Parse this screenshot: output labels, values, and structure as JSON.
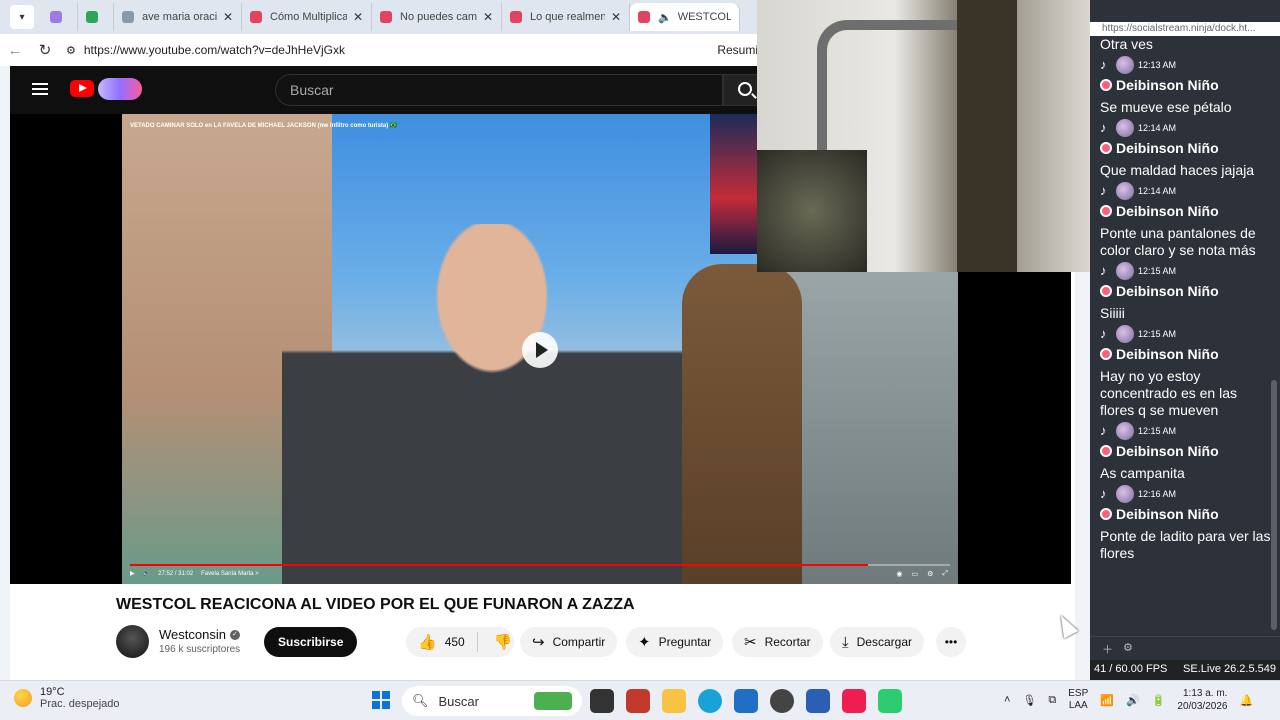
{
  "browser": {
    "tabs": [
      {
        "label": "",
        "color": "#9c7ce0"
      },
      {
        "label": "",
        "color": "#2da65a"
      },
      {
        "label": "ave maria oración",
        "color": "#8899aa"
      },
      {
        "label": "Cómo Multiplicar",
        "color": "#e2445f"
      },
      {
        "label": "No puedes cambi",
        "color": "#e2445f"
      },
      {
        "label": "Lo que realmente",
        "color": "#e2445f"
      },
      {
        "label": "WESTCOL RE",
        "color": "#e2445f"
      }
    ],
    "url": "https://www.youtube.com/watch?v=deJhHeVjGxk",
    "right_label": "Resumi"
  },
  "youtube": {
    "search_placeholder": "Buscar",
    "video_overlay_title": "VETADO CAMINAR SOLO en LA FAVELA DE MICHAEL JACKSON (me infiltro como turista) 🇧🇷",
    "time": "27:52 / 31:02",
    "chapter": "Favela Santa Marta >",
    "progress_fraction": 0.9,
    "video_title": "WESTCOL REACICONA AL VIDEO POR EL QUE FUNARON A ZAZZA",
    "channel": "Westconsin",
    "subscribers": "196 k suscriptores",
    "subscribe": "Suscribirse",
    "likes": "450",
    "share": "Compartir",
    "ask": "Preguntar",
    "clip": "Recortar",
    "download": "Descargar"
  },
  "chat": {
    "url": "https://socialstream.ninja/dock.ht...",
    "first_text": "Otra ves",
    "messages": [
      {
        "time": "12:13 AM",
        "name": "Deibinson Niño",
        "text": "Se mueve ese pétalo"
      },
      {
        "time": "12:14 AM",
        "name": "Deibinson Niño",
        "text": "Que maldad haces jajaja"
      },
      {
        "time": "12:14 AM",
        "name": "Deibinson Niño",
        "text": "Ponte una pantalones de color claro y se nota más"
      },
      {
        "time": "12:15 AM",
        "name": "Deibinson Niño",
        "text": "Siiiii"
      },
      {
        "time": "12:15 AM",
        "name": "Deibinson Niño",
        "text": "Hay no yo estoy concentrado es en las flores q se mueven"
      },
      {
        "time": "12:15 AM",
        "name": "Deibinson Niño",
        "text": "As campanita"
      },
      {
        "time": "12:16 AM",
        "name": "Deibinson Niño",
        "text": "Ponte de ladito para ver las flores"
      }
    ],
    "fps": "41 / 60.00 FPS",
    "version": "SE.Live 26.2.5.549"
  },
  "taskbar": {
    "temp": "19°C",
    "weather": "Prac. despejado",
    "search": "Buscar",
    "lang1": "ESP",
    "lang2": "LAA",
    "time": "1:13 a. m.",
    "date": "20/03/2026"
  }
}
